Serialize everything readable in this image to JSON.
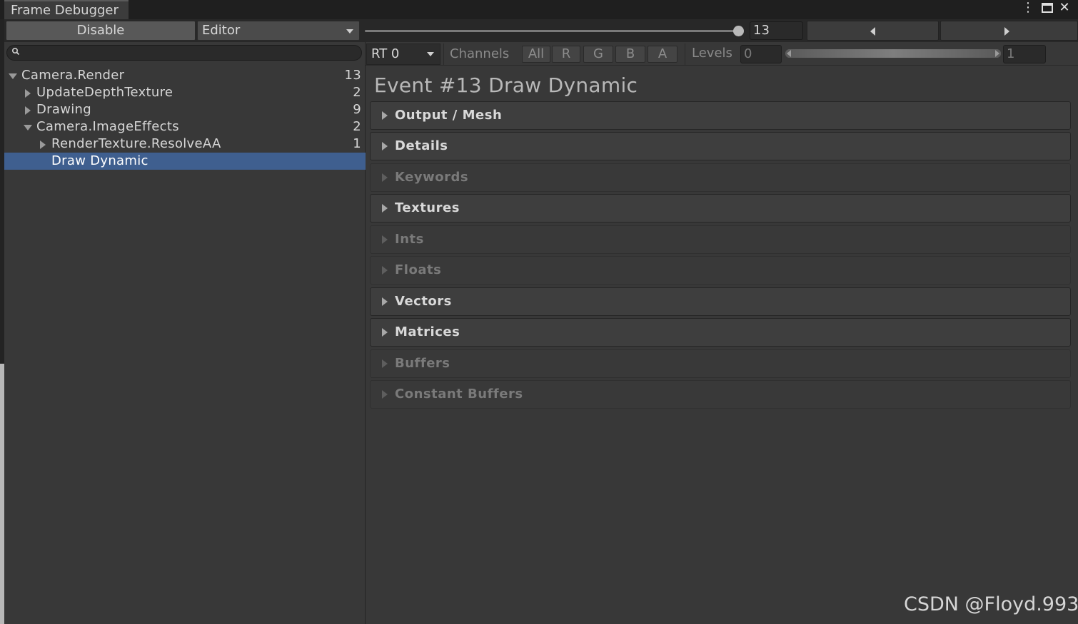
{
  "window": {
    "tab_title": "Frame Debugger"
  },
  "toolbar": {
    "disable_label": "Disable",
    "target_value": "Editor",
    "event_number": "13"
  },
  "tree": [
    {
      "label": "Camera.Render",
      "count": "13"
    },
    {
      "label": "UpdateDepthTexture",
      "count": "2"
    },
    {
      "label": "Drawing",
      "count": "9"
    },
    {
      "label": "Camera.ImageEffects",
      "count": "2"
    },
    {
      "label": "RenderTexture.ResolveAA",
      "count": "1"
    },
    {
      "label": "Draw Dynamic",
      "count": ""
    }
  ],
  "render_target": {
    "rt_value": "RT 0",
    "channels_label": "Channels",
    "channels": [
      "All",
      "R",
      "G",
      "B",
      "A"
    ],
    "levels_label": "Levels",
    "levels_min": "0",
    "levels_max": "1"
  },
  "event_title": "Event #13 Draw Dynamic",
  "sections": [
    {
      "label": "Output / Mesh",
      "enabled": true
    },
    {
      "label": "Details",
      "enabled": true
    },
    {
      "label": "Keywords",
      "enabled": false
    },
    {
      "label": "Textures",
      "enabled": true
    },
    {
      "label": "Ints",
      "enabled": false
    },
    {
      "label": "Floats",
      "enabled": false
    },
    {
      "label": "Vectors",
      "enabled": true
    },
    {
      "label": "Matrices",
      "enabled": true
    },
    {
      "label": "Buffers",
      "enabled": false
    },
    {
      "label": "Constant Buffers",
      "enabled": false
    }
  ],
  "watermark": "CSDN @Floyd.993",
  "colors": {
    "selection": "#3f5f8f",
    "panel": "#383838",
    "toolbar": "#282828"
  }
}
